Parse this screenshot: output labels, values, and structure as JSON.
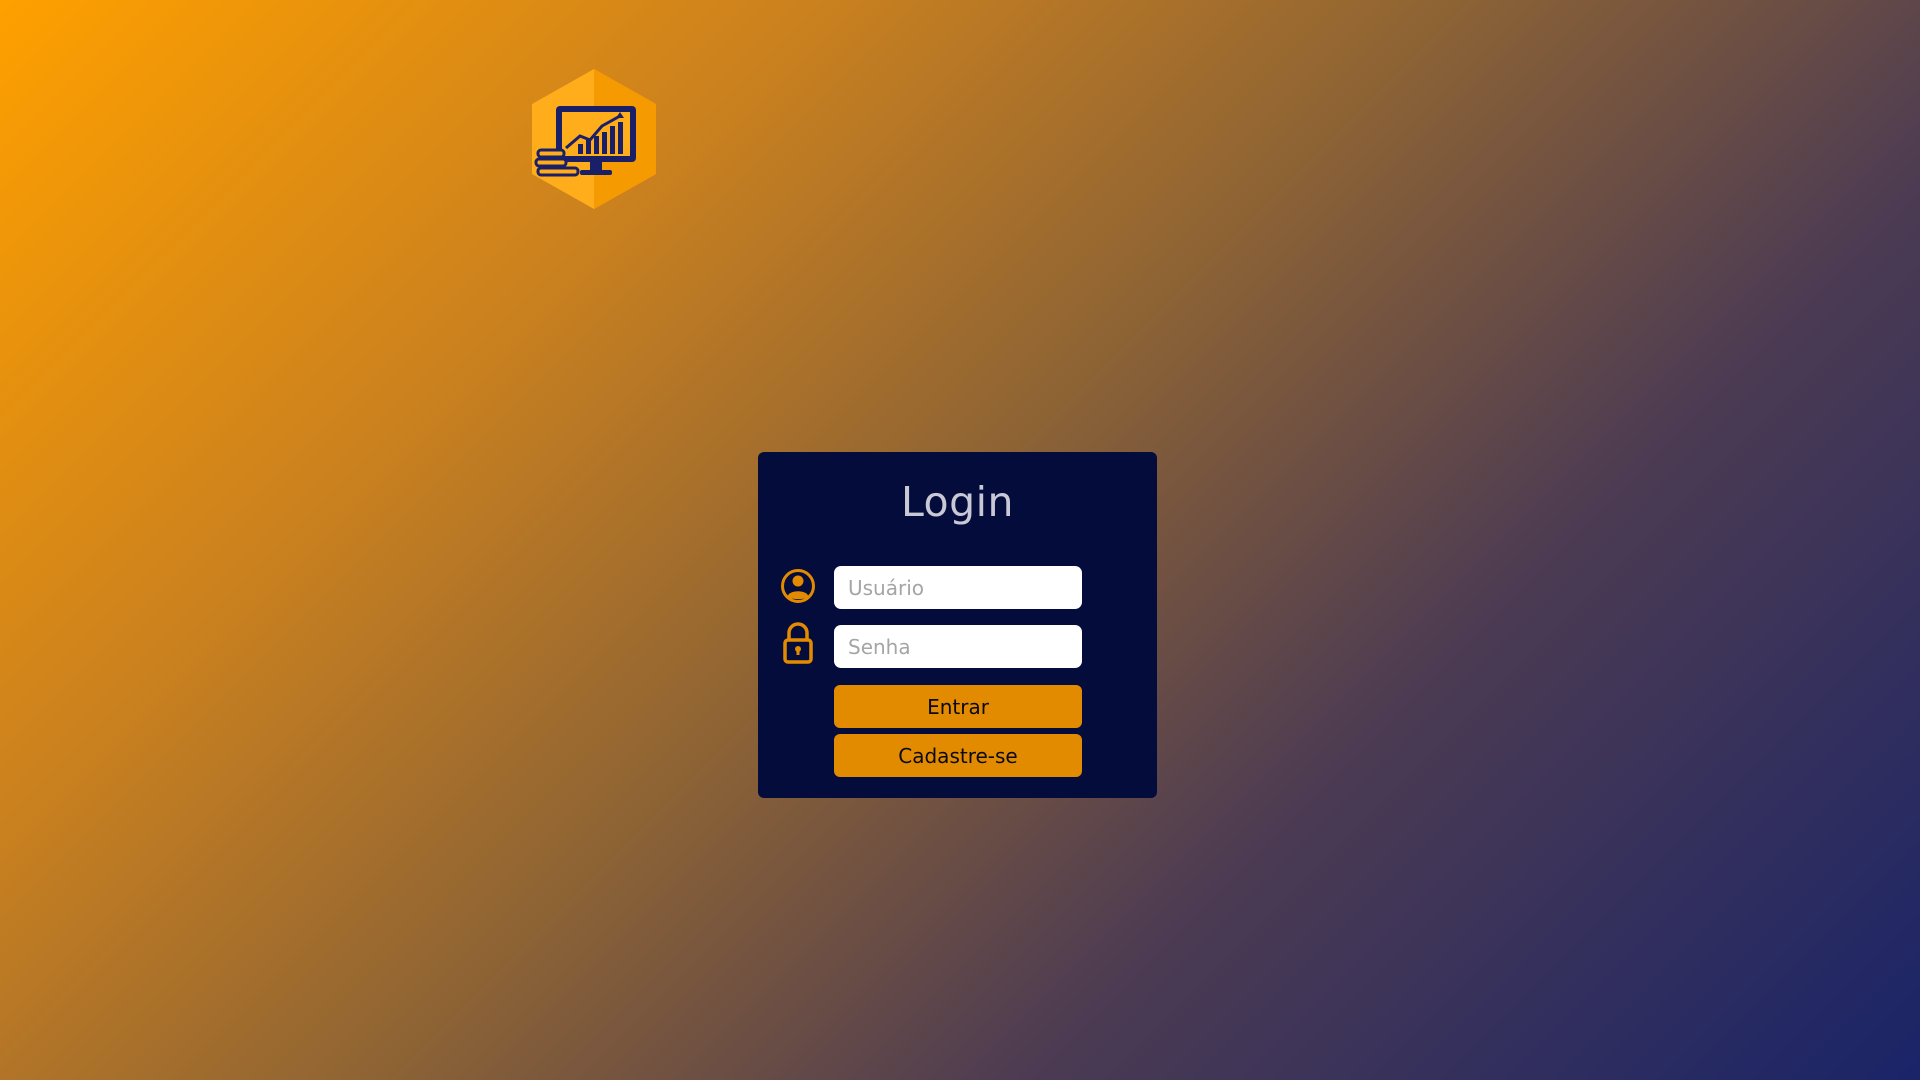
{
  "logo": {
    "icon": "monitor-chart-icon",
    "hex_color": "#ffad1a",
    "hex_shade_color": "#f59a00",
    "art_color": "#1a2068"
  },
  "background": {
    "gradient_start": "#ffa000",
    "gradient_end": "#1a2468"
  },
  "login": {
    "title": "Login",
    "card_color": "#040c3c",
    "username": {
      "icon": "user-icon",
      "placeholder": "Usuário",
      "value": ""
    },
    "password": {
      "icon": "lock-icon",
      "placeholder": "Senha",
      "value": ""
    },
    "submit_label": "Entrar",
    "register_label": "Cadastre-se",
    "accent_color": "#e38b00"
  }
}
